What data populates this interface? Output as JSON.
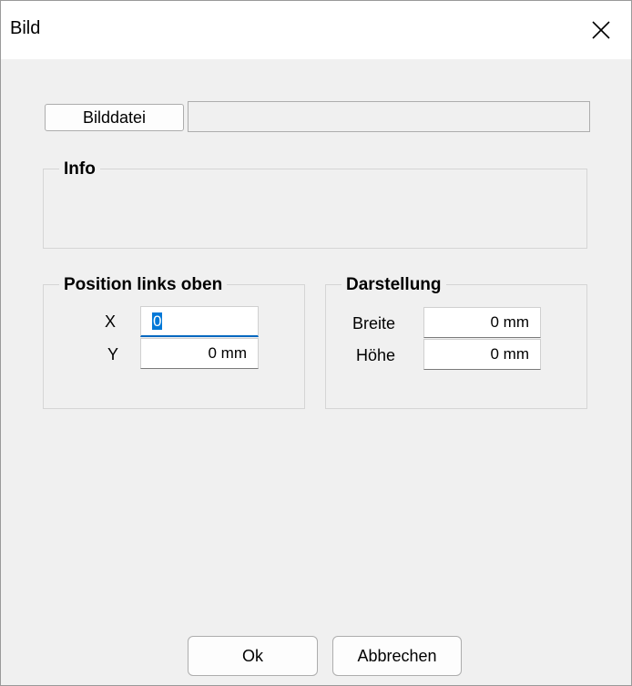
{
  "window": {
    "title": "Bild"
  },
  "icons": {
    "close": "close-icon"
  },
  "file": {
    "button_label": "Bilddatei",
    "path_value": ""
  },
  "info": {
    "legend": "Info"
  },
  "position": {
    "legend": "Position links oben",
    "x_label": "X",
    "x_value": "0",
    "y_label": "Y",
    "y_value": "0 mm"
  },
  "display": {
    "legend": "Darstellung",
    "width_label": "Breite",
    "width_value": "0 mm",
    "height_label": "Höhe",
    "height_value": "0 mm"
  },
  "footer": {
    "ok_label": "Ok",
    "cancel_label": "Abbrechen"
  },
  "colors": {
    "selection": "#0078d7",
    "focus_underline": "#0067c0"
  }
}
